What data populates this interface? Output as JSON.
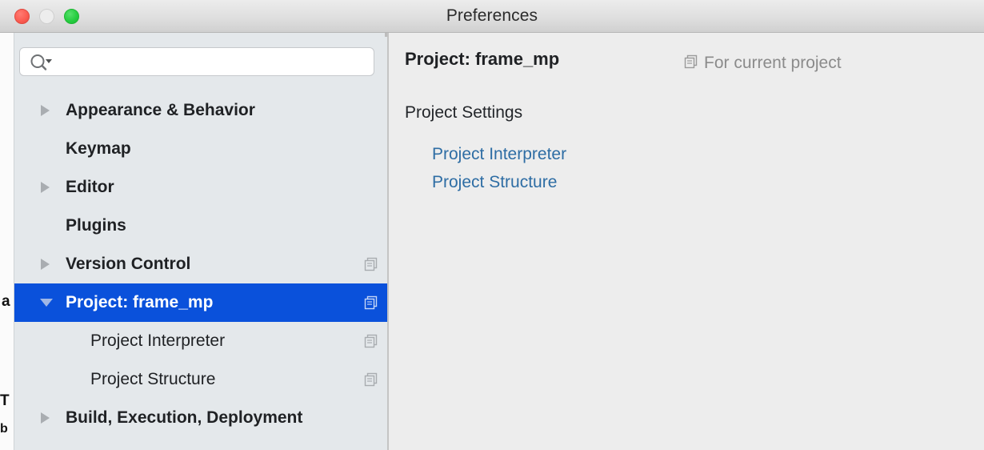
{
  "window": {
    "title": "Preferences",
    "traffic_lights": {
      "close": "close-button",
      "minimize": "minimize-button",
      "zoom": "zoom-button"
    }
  },
  "colors": {
    "selection_blue": "#0a51db",
    "link_blue": "#2e6da4",
    "sidebar_bg": "#e4e8eb",
    "detail_bg": "#ededed",
    "titlebar_top": "#ececec",
    "titlebar_bottom": "#d0d0d0",
    "text": "#1f2124",
    "muted_text": "#8b8b8b"
  },
  "sidebar": {
    "search": {
      "value": "",
      "placeholder": "",
      "icon": "search-icon",
      "dropdown_icon": "chevron-down-icon"
    },
    "items": [
      {
        "label": "Appearance & Behavior",
        "level": 0,
        "twisty": "collapsed",
        "selected": false,
        "copy_badge": false
      },
      {
        "label": "Keymap",
        "level": 0,
        "twisty": "none",
        "selected": false,
        "copy_badge": false
      },
      {
        "label": "Editor",
        "level": 0,
        "twisty": "collapsed",
        "selected": false,
        "copy_badge": false
      },
      {
        "label": "Plugins",
        "level": 0,
        "twisty": "none",
        "selected": false,
        "copy_badge": false
      },
      {
        "label": "Version Control",
        "level": 0,
        "twisty": "collapsed",
        "selected": false,
        "copy_badge": true
      },
      {
        "label": "Project: frame_mp",
        "level": 0,
        "twisty": "expanded",
        "selected": true,
        "copy_badge": true
      },
      {
        "label": "Project Interpreter",
        "level": 1,
        "twisty": "none",
        "selected": false,
        "copy_badge": true
      },
      {
        "label": "Project Structure",
        "level": 1,
        "twisty": "none",
        "selected": false,
        "copy_badge": true
      },
      {
        "label": "Build, Execution, Deployment",
        "level": 0,
        "twisty": "collapsed",
        "selected": false,
        "copy_badge": false
      }
    ]
  },
  "detail": {
    "title": "Project: frame_mp",
    "scope": {
      "icon": "copy-icon",
      "label": "For current project"
    },
    "section_title": "Project Settings",
    "links": [
      {
        "label": "Project Interpreter"
      },
      {
        "label": "Project Structure"
      }
    ]
  },
  "background_window": {
    "fragments": [
      "a",
      "T",
      "b"
    ]
  }
}
